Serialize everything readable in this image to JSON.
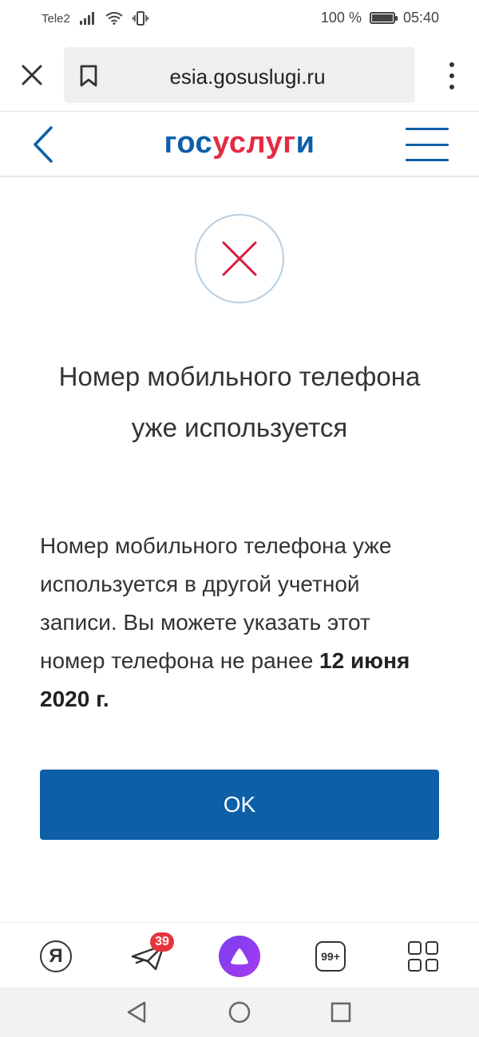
{
  "status_bar": {
    "carrier": "Tele2",
    "battery_percent": "100 %",
    "battery_level": 1.0,
    "time": "05:40"
  },
  "browser": {
    "url": "esia.gosuslugi.ru"
  },
  "site_header": {
    "logo_part1": "гос",
    "logo_part2": "услуг",
    "logo_part3": "и"
  },
  "dialog": {
    "title": "Номер мобильного телефона уже используется",
    "message": "Номер мобильного телефона уже используется в другой учетной записи. Вы можете указать этот номер телефона не ранее ",
    "message_bold": "12 июня 2020 г.",
    "ok_label": "OK"
  },
  "toolbar": {
    "yandex_letter": "Я",
    "mail_badge": "39",
    "tabs_count": "99+"
  },
  "colors": {
    "brand_blue": "#0d5fa8",
    "brand_red": "#e22c43",
    "error_cross": "#d41c3b"
  }
}
